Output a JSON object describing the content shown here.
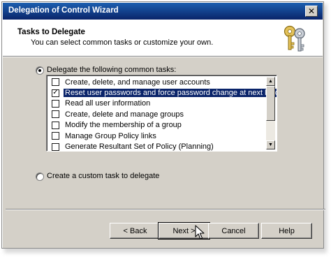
{
  "window": {
    "title": "Delegation of Control Wizard",
    "close_glyph": "✕"
  },
  "header": {
    "title": "Tasks to Delegate",
    "subtitle": "You can select common tasks or customize your own.",
    "icon": "keys-icon"
  },
  "options": {
    "common": {
      "label": "Delegate the following common tasks:",
      "selected": true
    },
    "custom": {
      "label": "Create a custom task to delegate",
      "selected": false
    }
  },
  "tasks": [
    {
      "label": "Create, delete, and manage user accounts",
      "checked": false,
      "mark": ""
    },
    {
      "label": "Reset user passwords and force password change at next logon",
      "checked": true,
      "mark": "✓"
    },
    {
      "label": "Read all user information",
      "checked": false,
      "mark": ""
    },
    {
      "label": "Create, delete and manage groups",
      "checked": false,
      "mark": ""
    },
    {
      "label": "Modify the membership of a group",
      "checked": false,
      "mark": ""
    },
    {
      "label": "Manage Group Policy links",
      "checked": false,
      "mark": ""
    },
    {
      "label": "Generate Resultant Set of Policy (Planning)",
      "checked": false,
      "mark": ""
    }
  ],
  "buttons": {
    "back": "< Back",
    "next": "Next >",
    "cancel": "Cancel",
    "help": "Help"
  },
  "colors": {
    "title_bar": "#0a246a",
    "selection": "#0a246a",
    "dialog_face": "#d4d0c8"
  }
}
